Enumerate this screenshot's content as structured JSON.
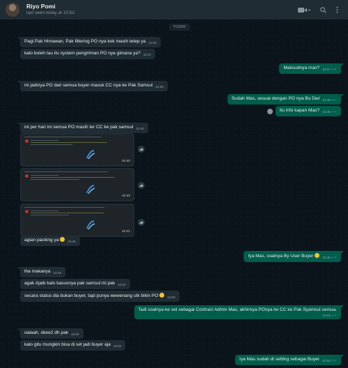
{
  "header": {
    "name": "Riyo Pomi",
    "status": "last seen today at 10:52"
  },
  "day_label": "TODAY",
  "messages": [
    {
      "text": "Pagi Pak Himawan, Pak filtering PO nya kok masih tetep ya",
      "time": "10:36"
    },
    {
      "text": "kalo boleh tau itu system pengiriman PO nya gimana ya?",
      "time": "10:37"
    },
    {
      "text": "Maksudnya mas?",
      "time": "10:37"
    },
    {
      "text": "ini jadinya PO dari semua buyer masuk CC nya ke Pak Samsul",
      "time": "10:38"
    },
    {
      "text": "Sudah Mas, sesuai dengan PO nya Bu Dwi",
      "time": "10:38"
    },
    {
      "text": "Itu info kapan Mas?",
      "time": "10:39"
    },
    {
      "text": "ini per hari ini semua PO masih ter CC ke pak samsul",
      "time": "10:40"
    },
    {
      "text": "",
      "time": "10:40"
    },
    {
      "text": "",
      "time": "10:40"
    },
    {
      "text": "",
      "time": "10:41"
    },
    {
      "text": "agian packing ya",
      "time": "10:45"
    },
    {
      "text": "Iya Mas, soalnya By User Buyer",
      "time": "10:46"
    },
    {
      "text": "lha makanya",
      "time": "10:49"
    },
    {
      "text": "agak Ajaib kalo kasusnya pak samsul ini pak",
      "time": "10:50"
    },
    {
      "text": "secara status dia bukan buyer, tapi punya wewenang utk bikin PO",
      "time": "10:50"
    },
    {
      "text": "Tadi soalnya ke set sebagai Contract Admin Mas, akhirnya POnya ke CC ke Pak Syamsul semua.",
      "time": "10:51"
    },
    {
      "text": "oalaah, okee2 dh pak",
      "time": "10:52"
    },
    {
      "text": "kalo gitu mungkin bisa di set jadi buyer aja",
      "time": "10:52"
    },
    {
      "text": "Iya Mas sudah di setting sebagai Buyer",
      "time": "10:52"
    }
  ],
  "ticks": "✓✓",
  "icons": [
    "video-call-icon",
    "chevron-down-icon",
    "search-icon",
    "menu-icon",
    "forward-icon",
    "emoji-icon"
  ]
}
